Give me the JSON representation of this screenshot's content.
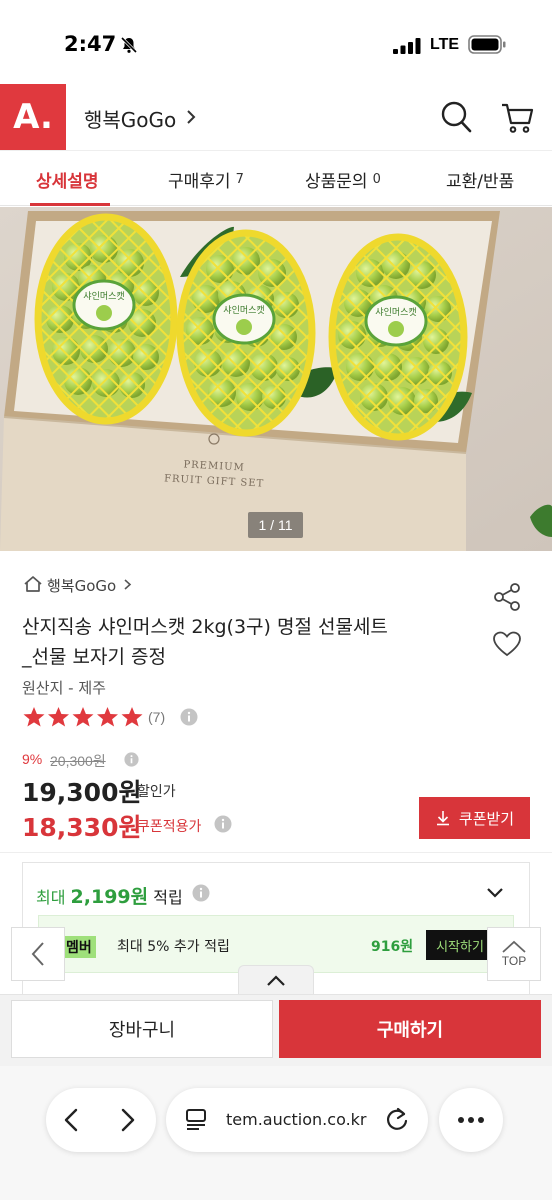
{
  "status_bar": {
    "time": "2:47",
    "network": "LTE"
  },
  "header": {
    "logo": "A.",
    "store_name": "행복GoGo"
  },
  "tabs": [
    {
      "label": "상세설명",
      "count": ""
    },
    {
      "label": "구매후기",
      "count": "7"
    },
    {
      "label": "상품문의",
      "count": "0"
    },
    {
      "label": "교환/반품",
      "count": ""
    }
  ],
  "gallery": {
    "counter": "1 / 11",
    "box_text_line1": "PREMIUM",
    "box_text_line2": "FRUIT GIFT SET",
    "label_text": "샤인머스캣"
  },
  "product": {
    "breadcrumb": "행복GoGo",
    "title_line1": "산지직송 샤인머스캣 2kg(3구) 명절 선물세트",
    "title_line2": "_선물 보자기 증정",
    "origin": "원산지 - 제주",
    "rating": 5,
    "review_count": "(7)",
    "discount": "9%",
    "original_price": "20,300원",
    "price": "19,300원",
    "price_tag": "할인가",
    "coupon_price": "18,330원",
    "coupon_tag": "쿠폰적용가",
    "coupon_button": "쿠폰받기"
  },
  "points": {
    "prefix": "최대",
    "amount": "2,199원",
    "suffix": "적립",
    "member_badge": "멤버",
    "member_text": "최대 5% 추가 적립",
    "member_amount": "916원",
    "member_start": "시작하기"
  },
  "floating": {
    "top_label": "TOP"
  },
  "actions": {
    "cart": "장바구니",
    "buy": "구매하기"
  },
  "browser": {
    "url": "tem.auction.co.kr"
  },
  "colors": {
    "brand": "#e0393e",
    "accent": "#d8353a",
    "green": "#2e9e3e"
  }
}
